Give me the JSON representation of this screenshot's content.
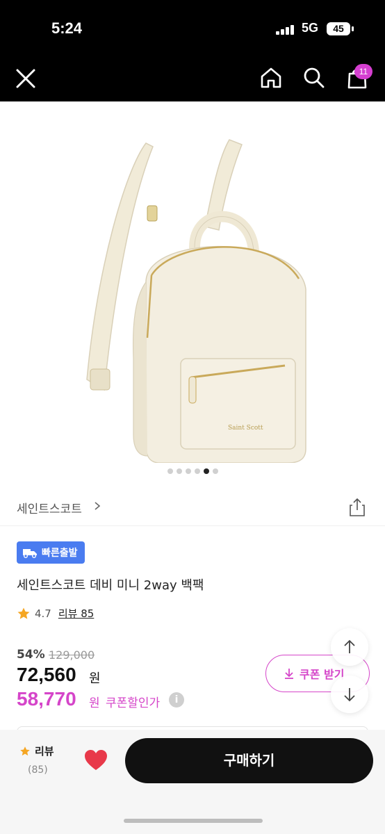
{
  "status_bar": {
    "time": "5:24",
    "network": "5G",
    "battery": "45"
  },
  "header": {
    "cart_badge": "11"
  },
  "gallery": {
    "dot_count": 6,
    "active_index": 4
  },
  "brand": {
    "name": "세인트스코트"
  },
  "product": {
    "badge": "빠른출발",
    "title": "세인트스코트 데비 미니 2way 백팩",
    "rating": "4.7",
    "review_link": "리뷰 85"
  },
  "pricing": {
    "discount": "54%",
    "original_price": "129,000",
    "price": "72,560",
    "price_unit": "원",
    "coupon_price": "58,770",
    "coupon_unit": "원",
    "coupon_label": "쿠폰할인가",
    "info_symbol": "i",
    "coupon_button": "쿠폰 받기"
  },
  "bottom_bar": {
    "review_label": "리뷰",
    "review_count": "(85)",
    "buy_button": "구매하기"
  },
  "colors": {
    "accent_pink": "#d545c9",
    "badge_blue": "#4a7cf0",
    "heart_red": "#e8394a",
    "star_yellow": "#f5a623"
  }
}
